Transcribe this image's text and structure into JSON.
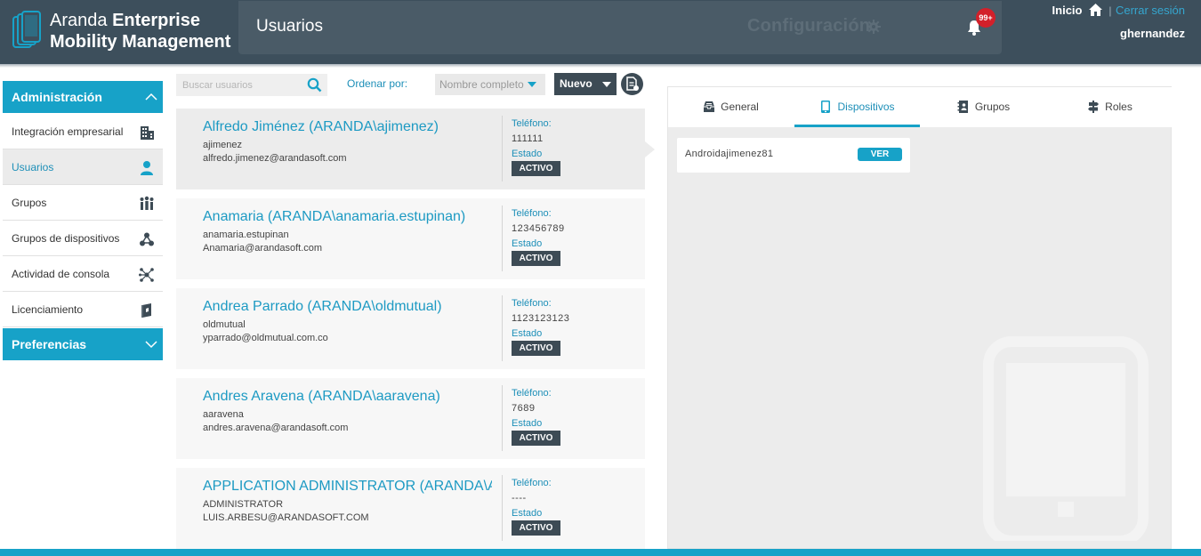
{
  "app": {
    "brand_light": "Aranda ",
    "brand_bold": "Enterprise",
    "brand_line2": "Mobility Management",
    "page_title": "Usuarios",
    "config_label": "Configuración",
    "notifications_badge": "99+",
    "home_link": "Inicio",
    "separator": "|",
    "logout_link": "Cerrar sesión",
    "username": "ghernandez"
  },
  "sidebar": {
    "admin_header": "Administración",
    "items": [
      {
        "label": "Integración empresarial",
        "icon": "building-icon"
      },
      {
        "label": "Usuarios",
        "icon": "user-icon",
        "active": true
      },
      {
        "label": "Grupos",
        "icon": "people-group-icon"
      },
      {
        "label": "Grupos de dispositivos",
        "icon": "device-groups-icon"
      },
      {
        "label": "Actividad de consola",
        "icon": "network-icon"
      },
      {
        "label": "Licenciamiento",
        "icon": "license-book-icon"
      }
    ],
    "prefs_header": "Preferencias"
  },
  "toolbar": {
    "search_placeholder": "Buscar usuarios",
    "sort_label": "Ordenar por:",
    "sort_value": "Nombre completo",
    "new_label": "Nuevo"
  },
  "users": [
    {
      "name": "Alfredo Jiménez (ARANDA\\ajimenez)",
      "login": "ajimenez",
      "email": "alfredo.jimenez@arandasoft.com",
      "tel_label": "Teléfono:",
      "tel": "111111",
      "estado_label": "Estado",
      "status": "ACTIVO"
    },
    {
      "name": "Anamaria (ARANDA\\anamaria.estupinan)",
      "login": "anamaria.estupinan",
      "email": "Anamaria@arandasoft.com",
      "tel_label": "Teléfono:",
      "tel": "123456789",
      "estado_label": "Estado",
      "status": "ACTIVO"
    },
    {
      "name": "Andrea Parrado (ARANDA\\oldmutual)",
      "login": "oldmutual",
      "email": "yparrado@oldmutual.com.co",
      "tel_label": "Teléfono:",
      "tel": "1123123123",
      "estado_label": "Estado",
      "status": "ACTIVO"
    },
    {
      "name": "Andres Aravena (ARANDA\\aaravena)",
      "login": "aaravena",
      "email": "andres.aravena@arandasoft.com",
      "tel_label": "Teléfono:",
      "tel": "7689",
      "estado_label": "Estado",
      "status": "ACTIVO"
    },
    {
      "name": "APPLICATION ADMINISTRATOR (ARANDA\\AD...",
      "login": "ADMINISTRATOR",
      "email": "LUIS.ARBESU@ARANDASOFT.COM",
      "tel_label": "Teléfono:",
      "tel": "----",
      "estado_label": "Estado",
      "status": "ACTIVO"
    }
  ],
  "detail": {
    "tabs": [
      {
        "label": "General",
        "icon": "inbox-icon"
      },
      {
        "label": "Dispositivos",
        "icon": "tablet-icon",
        "active": true
      },
      {
        "label": "Grupos",
        "icon": "group-book-icon"
      },
      {
        "label": "Roles",
        "icon": "signpost-icon"
      }
    ],
    "devices": [
      {
        "name": "Androidajimenez81",
        "action": "VER"
      }
    ]
  },
  "colors": {
    "accent": "#17a2c8",
    "topbar": "#3d4f5c",
    "badge": "#d3202a",
    "status_bg": "#3d4b55"
  }
}
